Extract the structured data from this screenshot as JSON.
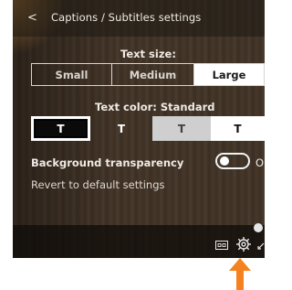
{
  "header": {
    "back_glyph": "<",
    "title": "Captions / Subtitles settings"
  },
  "text_size": {
    "label": "Text size:",
    "options": [
      "Small",
      "Medium",
      "Large"
    ],
    "selected": "Large"
  },
  "text_color": {
    "label": "Text color: Standard",
    "swatches": [
      {
        "glyph": "T",
        "bg": "#0a0a0a",
        "fg": "#ffffff",
        "selected": true
      },
      {
        "glyph": "T",
        "bg": "transparent",
        "fg": "#ffffff",
        "selected": false
      },
      {
        "glyph": "T",
        "bg": "#cfcfcf",
        "fg": "#404040",
        "selected": false
      },
      {
        "glyph": "T",
        "bg": "#ffffff",
        "fg": "#111111",
        "selected": false
      }
    ]
  },
  "background_transparency": {
    "label": "Background transparency",
    "toggle_state_text": "O",
    "enabled": false
  },
  "revert_label": "Revert to default settings",
  "player_controls": {
    "icons": [
      "closed-captions-icon",
      "gear-icon",
      "resize-icon"
    ]
  },
  "annotation": {
    "arrow_color": "#f5821f",
    "points_to": "gear-icon"
  }
}
